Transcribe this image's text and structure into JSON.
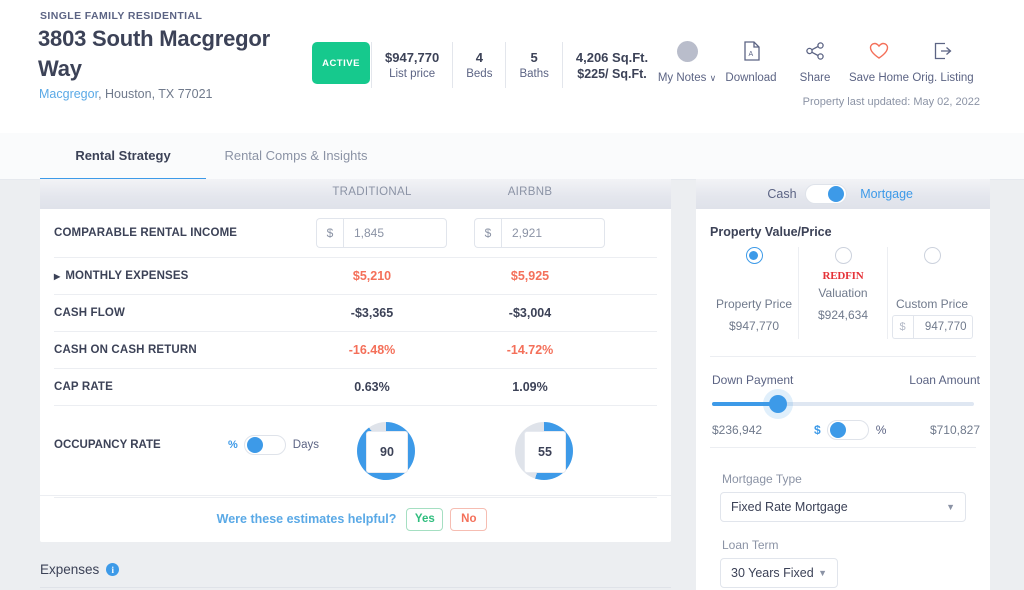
{
  "header": {
    "property_type": "SINGLE FAMILY RESIDENTIAL",
    "title": "3803 South Macgregor Way",
    "neighborhood": "Macgregor",
    "address_rest": ", Houston, TX 77021",
    "status_badge": "ACTIVE",
    "stats": [
      {
        "value": "$947,770",
        "label": "List price"
      },
      {
        "value": "4",
        "label": "Beds"
      },
      {
        "value": "5",
        "label": "Baths"
      },
      {
        "value": "4,206 Sq.Ft.",
        "label": "$225/ Sq.Ft."
      }
    ],
    "actions": [
      {
        "label": "My Notes",
        "icon": "avatar-icon",
        "caret": "∨"
      },
      {
        "label": "Download",
        "icon": "download-pdf-icon"
      },
      {
        "label": "Share",
        "icon": "share-icon"
      },
      {
        "label": "Save Home",
        "icon": "heart-icon"
      },
      {
        "label": "Orig. Listing",
        "icon": "external-link-icon"
      }
    ],
    "last_updated": "Property last updated: May 02, 2022"
  },
  "tabs": [
    {
      "label": "Rental Strategy",
      "active": true
    },
    {
      "label": "Rental Comps & Insights",
      "active": false
    }
  ],
  "strategy_table": {
    "columns": [
      "TRADITIONAL",
      "AIRBNB"
    ],
    "rows": [
      {
        "label": "COMPARABLE RENTAL INCOME",
        "type": "input",
        "currency": "$",
        "traditional": "1,845",
        "airbnb": "2,921"
      },
      {
        "label": "MONTHLY EXPENSES",
        "type": "expandable",
        "traditional": "$5,210",
        "airbnb": "$5,925",
        "negative": true
      },
      {
        "label": "CASH FLOW",
        "type": "value",
        "traditional": "-$3,365",
        "airbnb": "-$3,004",
        "negative": false
      },
      {
        "label": "CASH ON CASH RETURN",
        "type": "value",
        "traditional": "-16.48%",
        "airbnb": "-14.72%",
        "negative": true
      },
      {
        "label": "CAP RATE",
        "type": "value",
        "traditional": "0.63%",
        "airbnb": "1.09%",
        "negative": false
      }
    ],
    "occupancy": {
      "label": "OCCUPANCY RATE",
      "unit_left": "%",
      "unit_right": "Days",
      "toggle_on_right": true,
      "traditional_value": "90",
      "airbnb_value": "55",
      "traditional_pct": 90,
      "airbnb_pct": 55
    },
    "feedback": {
      "question": "Were these estimates helpful?",
      "yes": "Yes",
      "no": "No"
    }
  },
  "financing": {
    "mode_left": "Cash",
    "mode_right": "Mortgage",
    "mode_selected": "Mortgage",
    "property_value_title": "Property Value/Price",
    "options": [
      {
        "label": "Property Price",
        "value": "$947,770",
        "selected": true,
        "brand": ""
      },
      {
        "label": "Valuation",
        "value": "$924,634",
        "selected": false,
        "brand": "REDFIN"
      },
      {
        "label": "Custom Price",
        "value": "947,770",
        "selected": false,
        "brand": "",
        "currency": "$",
        "is_input": true
      }
    ],
    "down_payment_label": "Down Payment",
    "loan_amount_label": "Loan Amount",
    "down_payment_value": "$236,942",
    "loan_amount_value": "$710,827",
    "slider_percent": 25,
    "dp_unit_left": "$",
    "dp_unit_right": "%",
    "mortgage_type_label": "Mortgage Type",
    "mortgage_type_value": "Fixed Rate Mortgage",
    "loan_term_label": "Loan Term",
    "loan_term_value": "30 Years Fixed",
    "dropdown_arrow": "▼"
  },
  "expenses": {
    "label": "Expenses",
    "info": "i"
  },
  "colors": {
    "accent_blue": "#3d9ae8",
    "green": "#16c98d",
    "red": "#f4705a",
    "redfin_red": "#e53238",
    "text_dark": "#3c4257"
  }
}
